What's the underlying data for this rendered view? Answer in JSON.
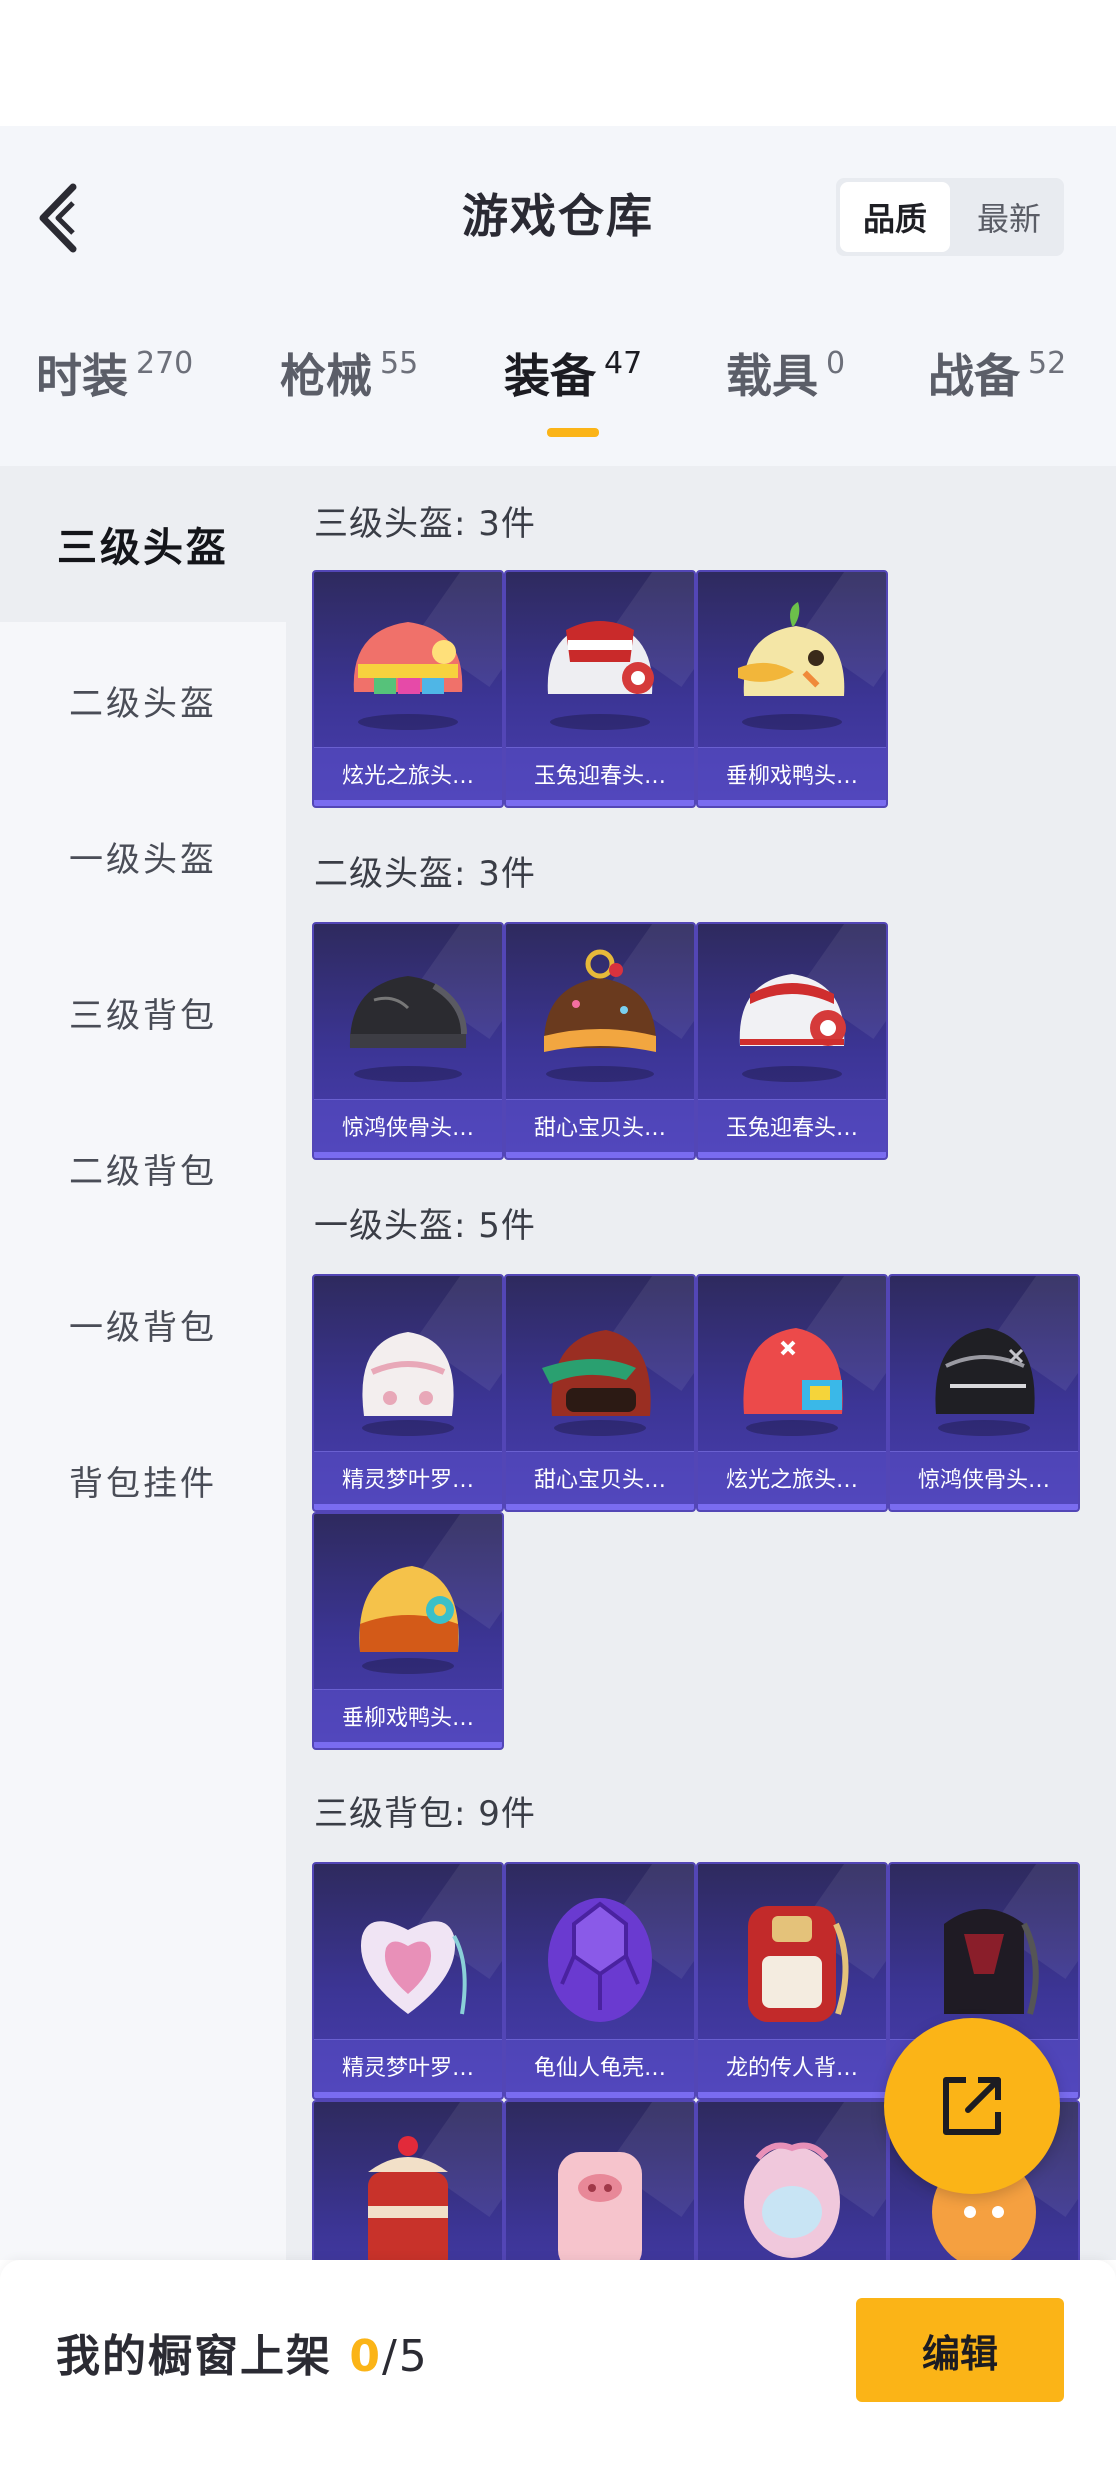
{
  "header": {
    "title": "游戏仓库",
    "sort_options": [
      "品质",
      "最新"
    ]
  },
  "tabs": [
    {
      "label": "时装",
      "count": "270"
    },
    {
      "label": "枪械",
      "count": "55"
    },
    {
      "label": "装备",
      "count": "47"
    },
    {
      "label": "载具",
      "count": "0"
    },
    {
      "label": "战备",
      "count": "52"
    }
  ],
  "active_tab": "装备",
  "sidebar": {
    "items": [
      "三级头盔",
      "二级头盔",
      "一级头盔",
      "三级背包",
      "二级背包",
      "一级背包",
      "背包挂件"
    ],
    "active": "三级头盔"
  },
  "sections": [
    {
      "title": "三级头盔: 3件",
      "items": [
        {
          "name": "炫光之旅头…",
          "icon": "helmet-pink-icon"
        },
        {
          "name": "玉兔迎春头…",
          "icon": "helmet-white-red-icon"
        },
        {
          "name": "垂柳戏鸭头…",
          "icon": "helmet-duck-icon"
        }
      ]
    },
    {
      "title": "二级头盔: 3件",
      "items": [
        {
          "name": "惊鸿侠骨头…",
          "icon": "helmet-black-icon"
        },
        {
          "name": "甜心宝贝头…",
          "icon": "helmet-chocolate-icon"
        },
        {
          "name": "玉兔迎春头…",
          "icon": "helmet-white-red-icon"
        }
      ]
    },
    {
      "title": "一级头盔: 5件",
      "items": [
        {
          "name": "精灵梦叶罗…",
          "icon": "helmet-white-pink-icon"
        },
        {
          "name": "甜心宝贝头…",
          "icon": "helmet-red-visor-icon"
        },
        {
          "name": "炫光之旅头…",
          "icon": "helmet-red-icon"
        },
        {
          "name": "惊鸿侠骨头…",
          "icon": "helmet-black-open-icon"
        },
        {
          "name": "垂柳戏鸭头…",
          "icon": "helmet-orange-icon"
        }
      ]
    },
    {
      "title": "三级背包: 9件",
      "items": [
        {
          "name": "精灵梦叶罗…",
          "icon": "backpack-heart-icon"
        },
        {
          "name": "龟仙人龟壳…",
          "icon": "backpack-turtle-icon"
        },
        {
          "name": "龙的传人背…",
          "icon": "backpack-red-icon"
        },
        {
          "name": "",
          "icon": "backpack-black-icon"
        },
        {
          "name": "",
          "icon": "backpack-cake-icon"
        },
        {
          "name": "",
          "icon": "backpack-pig-icon"
        },
        {
          "name": "",
          "icon": "backpack-fish-icon"
        },
        {
          "name": "",
          "icon": "backpack-orange-icon"
        }
      ]
    }
  ],
  "footer": {
    "label": "我的橱窗上架",
    "count": "0",
    "total": "/5",
    "edit_label": "编辑"
  },
  "colors": {
    "accent": "#fbb417",
    "card_bg": "#3c3596",
    "card_border": "#5346b6"
  }
}
